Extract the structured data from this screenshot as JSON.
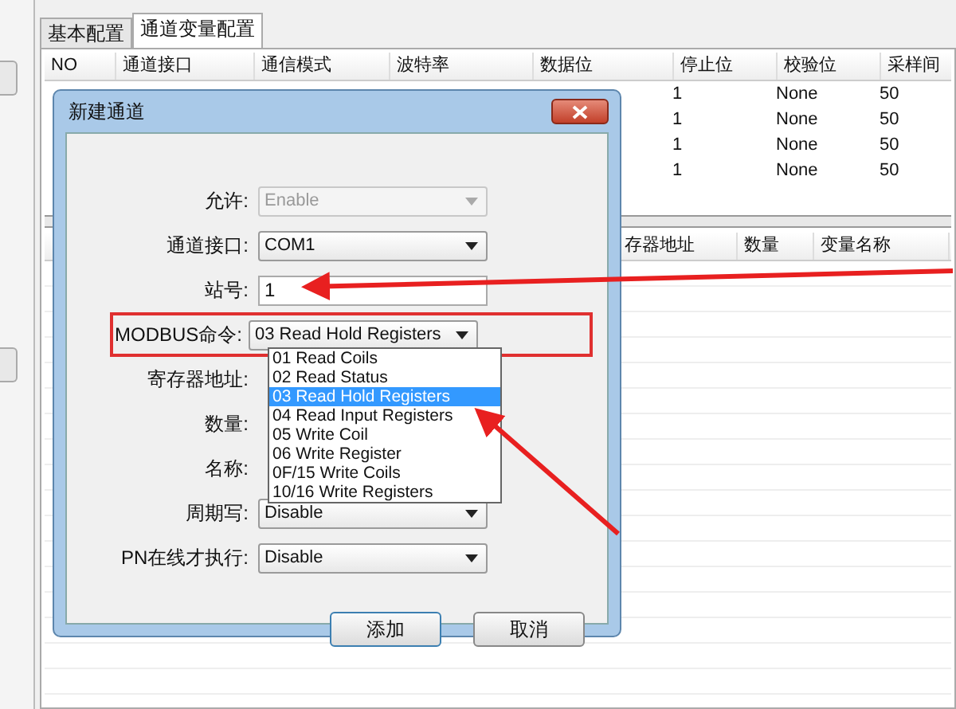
{
  "tabs": [
    {
      "label": "基本配置",
      "selected": false
    },
    {
      "label": "通道变量配置",
      "selected": true
    }
  ],
  "channel_table": {
    "columns": [
      "NO",
      "通道接口",
      "通信模式",
      "波特率",
      "数据位",
      "停止位",
      "校验位",
      "采样间"
    ],
    "rows": [
      {
        "stop_bits": "1",
        "parity": "None",
        "sample_interval": "50"
      },
      {
        "stop_bits": "1",
        "parity": "None",
        "sample_interval": "50"
      },
      {
        "stop_bits": "1",
        "parity": "None",
        "sample_interval": "50"
      },
      {
        "stop_bits": "1",
        "parity": "None",
        "sample_interval": "50"
      }
    ]
  },
  "variable_table": {
    "columns": [
      "存器地址",
      "数量",
      "变量名称"
    ]
  },
  "dialog": {
    "title": "新建通道",
    "fields": [
      {
        "label": "允许:",
        "kind": "dropdown",
        "value": "Enable",
        "disabled": true
      },
      {
        "label": "通道接口:",
        "kind": "dropdown",
        "value": "COM1",
        "disabled": false
      },
      {
        "label": "站号:",
        "kind": "input",
        "value": "1",
        "disabled": false
      },
      {
        "label": "MODBUS命令:",
        "kind": "dropdown",
        "value": "03 Read Hold Registers",
        "disabled": false
      },
      {
        "label": "寄存器地址:",
        "kind": "hidden"
      },
      {
        "label": "数量:",
        "kind": "hidden"
      },
      {
        "label": "名称:",
        "kind": "hidden"
      },
      {
        "label": "周期写:",
        "kind": "dropdown",
        "value": "Disable",
        "disabled": false
      },
      {
        "label": "PN在线才执行:",
        "kind": "dropdown",
        "value": "Disable",
        "disabled": false
      }
    ],
    "dropdown_list": {
      "options": [
        {
          "label": "01 Read Coils",
          "selected": false
        },
        {
          "label": "02 Read Status",
          "selected": false
        },
        {
          "label": "03 Read Hold Registers",
          "selected": true
        },
        {
          "label": "04 Read Input Registers",
          "selected": false
        },
        {
          "label": "05 Write Coil",
          "selected": false
        },
        {
          "label": "06 Write Register",
          "selected": false
        },
        {
          "label": "0F/15 Write Coils",
          "selected": false
        },
        {
          "label": "10/16 Write Registers",
          "selected": false
        }
      ]
    },
    "buttons": [
      "添加",
      "取消"
    ]
  }
}
